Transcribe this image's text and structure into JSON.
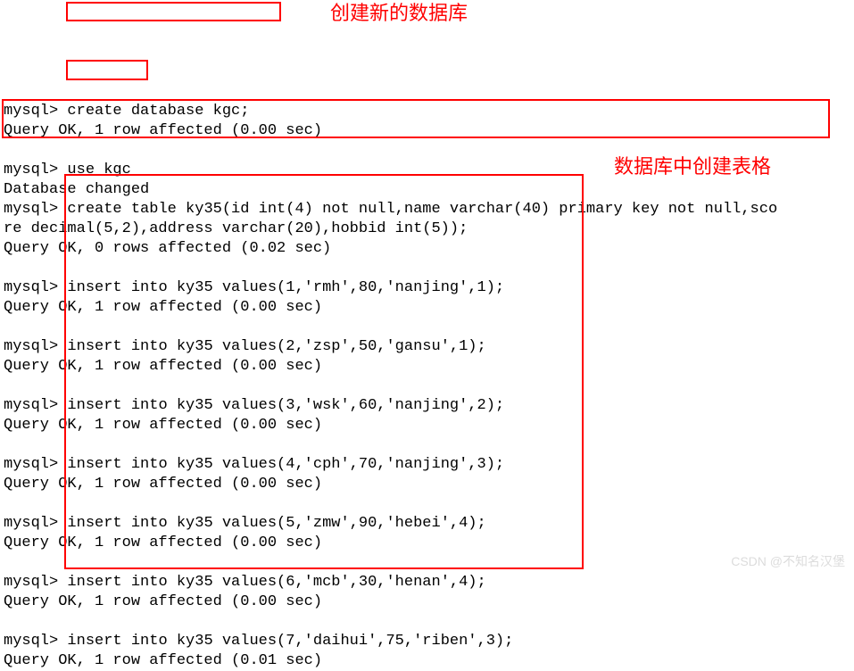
{
  "prompt": "mysql>",
  "commands": {
    "createDb": "create database kgc;",
    "useDb": "use kgc",
    "createTable": "create table ky35(id int(4) not null,name varchar(40) primary key not null,sco\nre decimal(5,2),address varchar(20),hobbid int(5));"
  },
  "responses": {
    "ok1row000": "Query OK, 1 row affected (0.00 sec)",
    "ok1row001": "Query OK, 1 row affected (0.01 sec)",
    "ok0rows002": "Query OK, 0 rows affected (0.02 sec)",
    "dbChanged": "Database changed"
  },
  "inserts": [
    "insert into ky35 values(1,'rmh',80,'nanjing',1);",
    "insert into ky35 values(2,'zsp',50,'gansu',1);",
    "insert into ky35 values(3,'wsk',60,'nanjing',2);",
    "insert into ky35 values(4,'cph',70,'nanjing',3);",
    "insert into ky35 values(5,'zmw',90,'hebei',4);",
    "insert into ky35 values(6,'mcb',30,'henan',4);",
    "insert into ky35 values(7,'daihui',75,'riben',3);"
  ],
  "annotations": {
    "createNewDb": "创建新的数据库",
    "createTableInDb": "数据库中创建表格"
  },
  "watermark": "CSDN @不知名汉堡"
}
